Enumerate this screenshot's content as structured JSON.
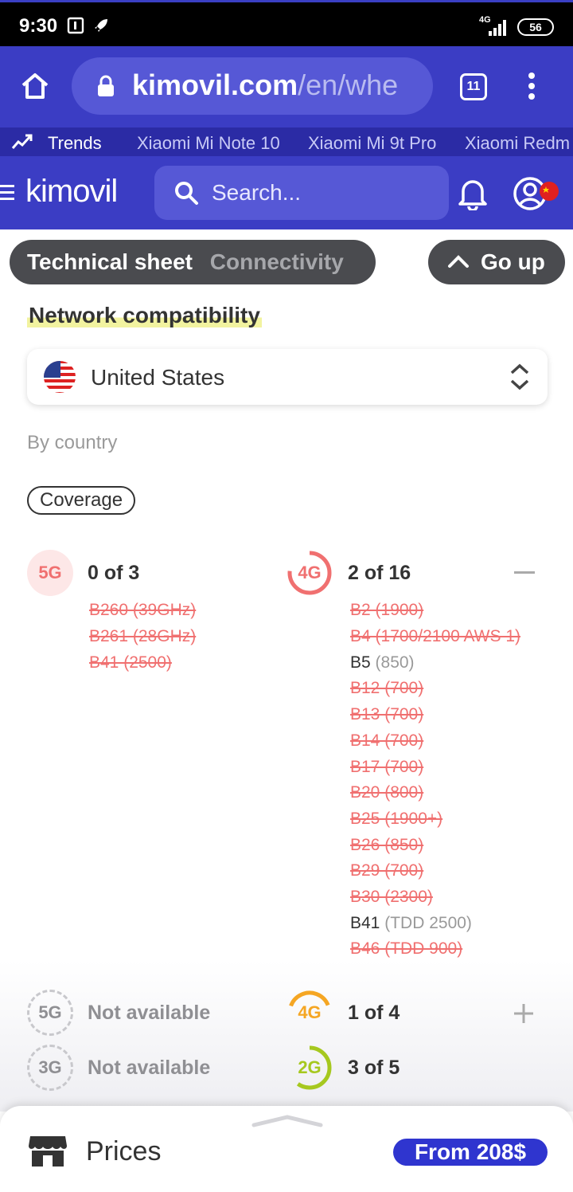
{
  "status_bar": {
    "time": "9:30",
    "network": "4G",
    "battery": "56"
  },
  "browser": {
    "url_host": "kimovil.com",
    "url_path": "/en/whe",
    "tab_count": "11"
  },
  "trends": {
    "label": "Trends",
    "items": [
      "Xiaomi Mi Note 10",
      "Xiaomi Mi 9t Pro",
      "Xiaomi Redm"
    ]
  },
  "site": {
    "logo": "kimovil",
    "search_placeholder": "Search..."
  },
  "sticky_nav": {
    "section": "Technical sheet",
    "subsection": "Connectivity",
    "go_up": "Go up"
  },
  "network": {
    "title": "Network compatibility",
    "country": "United States",
    "by_country": "By country",
    "coverage_label": "Coverage",
    "g5": {
      "badge": "5G",
      "count": "0 of 3",
      "bands": [
        {
          "name": "B260 (39GHz)",
          "supported": false
        },
        {
          "name": "B261 (28GHz)",
          "supported": false
        },
        {
          "name": "B41 (2500)",
          "supported": false
        }
      ]
    },
    "g4": {
      "badge": "4G",
      "count": "2 of 16",
      "supported_fraction": 0.125,
      "bands": [
        {
          "name": "B2 (1900)",
          "supported": false
        },
        {
          "name": "B4 (1700/2100 AWS 1)",
          "supported": false
        },
        {
          "name": "B5",
          "freq": "(850)",
          "supported": true
        },
        {
          "name": "B12 (700)",
          "supported": false
        },
        {
          "name": "B13 (700)",
          "supported": false
        },
        {
          "name": "B14 (700)",
          "supported": false
        },
        {
          "name": "B17 (700)",
          "supported": false
        },
        {
          "name": "B20 (800)",
          "supported": false
        },
        {
          "name": "B25 (1900+)",
          "supported": false
        },
        {
          "name": "B26 (850)",
          "supported": false
        },
        {
          "name": "B29 (700)",
          "supported": false
        },
        {
          "name": "B30 (2300)",
          "supported": false
        },
        {
          "name": "B41",
          "freq": "(TDD 2500)",
          "supported": true
        },
        {
          "name": "B46 (TDD 900)",
          "supported": false
        }
      ]
    },
    "other_carrier": {
      "g5": {
        "badge": "5G",
        "status": "Not available"
      },
      "g4": {
        "badge": "4G",
        "count": "1 of 4",
        "supported_fraction": 0.25
      },
      "g3": {
        "badge": "3G",
        "status": "Not available"
      },
      "g2": {
        "badge": "2G",
        "count": "3 of 5",
        "supported_fraction": 0.6
      }
    }
  },
  "prices": {
    "title": "Prices",
    "from": "From 208$"
  },
  "colors": {
    "brand": "#3b3dc4",
    "brand_dark": "#2b2ba5",
    "unsupported": "#f07070",
    "price_badge": "#2f35cf",
    "g4_partial": "#f5a623",
    "g2_partial": "#a6c81f"
  }
}
